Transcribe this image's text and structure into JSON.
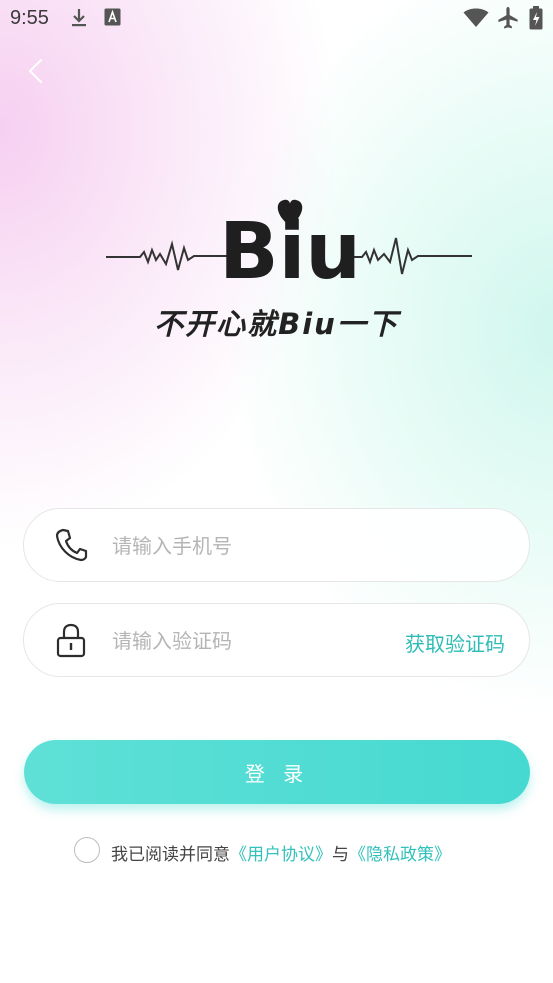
{
  "status_bar": {
    "time": "9:55",
    "icons": [
      "download-icon",
      "font-a-icon",
      "wifi-icon",
      "airplane-mode-icon",
      "battery-charging-icon"
    ]
  },
  "header": {
    "back_icon": "chevron-left-icon"
  },
  "brand": {
    "logo_text": "Biu",
    "slogan": "不开心就Biu一下"
  },
  "login_form": {
    "phone": {
      "placeholder": "请输入手机号",
      "value": "",
      "icon": "phone-icon"
    },
    "code": {
      "placeholder": "请输入验证码",
      "value": "",
      "icon": "lock-icon",
      "get_code_label": "获取验证码"
    },
    "login_label": "登 录"
  },
  "agreement": {
    "prefix": "我已阅读并同意",
    "user_agreement": "《用户协议》",
    "joiner": "与",
    "privacy_policy": "《隐私政策》",
    "checked": false
  },
  "colors": {
    "accent": "#45d9d1",
    "link": "#33c1bb",
    "placeholder": "#b5b5b5"
  }
}
